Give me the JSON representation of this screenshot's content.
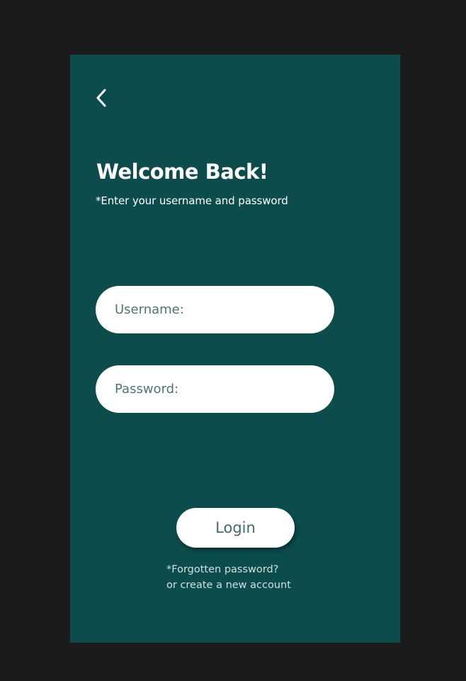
{
  "header": {
    "back_icon": "chevron-left-icon"
  },
  "welcome": {
    "title": "Welcome Back!",
    "subtitle": "*Enter your username and password"
  },
  "form": {
    "username_placeholder": "Username:",
    "password_placeholder": "Password:",
    "login_label": "Login"
  },
  "footer": {
    "forgot_password": "*Forgotten password?",
    "create_account": "or create a new account"
  },
  "colors": {
    "background": "#1b1b1b",
    "panel": "#0c4c4c",
    "field": "#ffffff",
    "accent_text": "#3e6b6b"
  }
}
